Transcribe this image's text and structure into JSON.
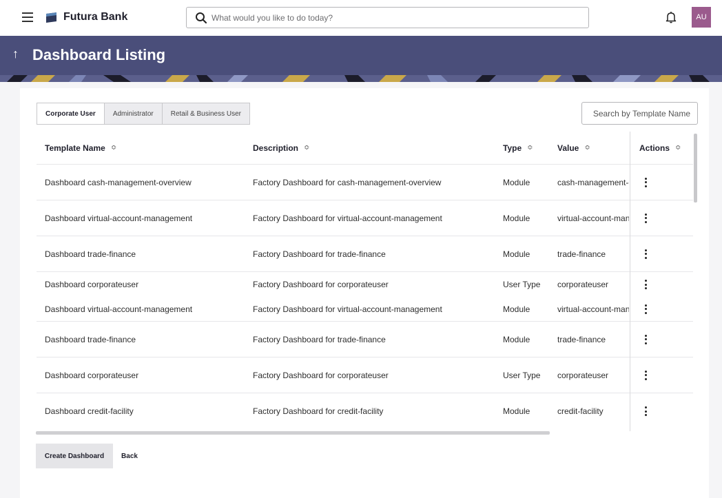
{
  "app": {
    "brand": "Futura Bank",
    "search_placeholder": "What would you like to do today?",
    "avatar_initials": "AU",
    "icons": [
      "hamburger-icon",
      "logo-icon",
      "search-icon",
      "bell-icon"
    ]
  },
  "header": {
    "back_symbol": "↑",
    "title": "Dashboard Listing"
  },
  "tabs": [
    {
      "label": "Corporate User",
      "active": true
    },
    {
      "label": "Administrator",
      "active": false
    },
    {
      "label": "Retail & Business User",
      "active": false
    }
  ],
  "table_search": {
    "placeholder": "Search by Template Name"
  },
  "table": {
    "sort_symbol": "≎",
    "columns": [
      "Template Name",
      "Description",
      "Type",
      "Value",
      "Actions"
    ],
    "rows": [
      {
        "name": "Dashboard cash-management-overview",
        "description": "Factory Dashboard for cash-management-overview",
        "type": "Module",
        "value": "cash-management-overview"
      },
      {
        "name": "Dashboard virtual-account-management",
        "description": "Factory Dashboard for virtual-account-management",
        "type": "Module",
        "value": "virtual-account-management"
      },
      {
        "name": "Dashboard trade-finance",
        "description": "Factory Dashboard for trade-finance",
        "type": "Module",
        "value": "trade-finance"
      },
      {
        "name": "Dashboard corporateuser",
        "description": "Factory Dashboard for corporateuser",
        "type": "User Type",
        "value": "corporateuser"
      },
      {
        "name": "Dashboard virtual-account-management",
        "description": "Factory Dashboard for virtual-account-management",
        "type": "Module",
        "value": "virtual-account-management"
      },
      {
        "name": "Dashboard trade-finance",
        "description": "Factory Dashboard for trade-finance",
        "type": "Module",
        "value": "trade-finance"
      },
      {
        "name": "Dashboard corporateuser",
        "description": "Factory Dashboard for corporateuser",
        "type": "User Type",
        "value": "corporateuser"
      },
      {
        "name": "Dashboard credit-facility",
        "description": "Factory Dashboard for credit-facility",
        "type": "Module",
        "value": "credit-facility"
      }
    ]
  },
  "footer": {
    "create_label": "Create Dashboard",
    "back_label": "Back"
  },
  "colors": {
    "header_band": "#4a4e7a",
    "avatar": "#9b5b8d",
    "accent_deco": "#c9a84a"
  }
}
